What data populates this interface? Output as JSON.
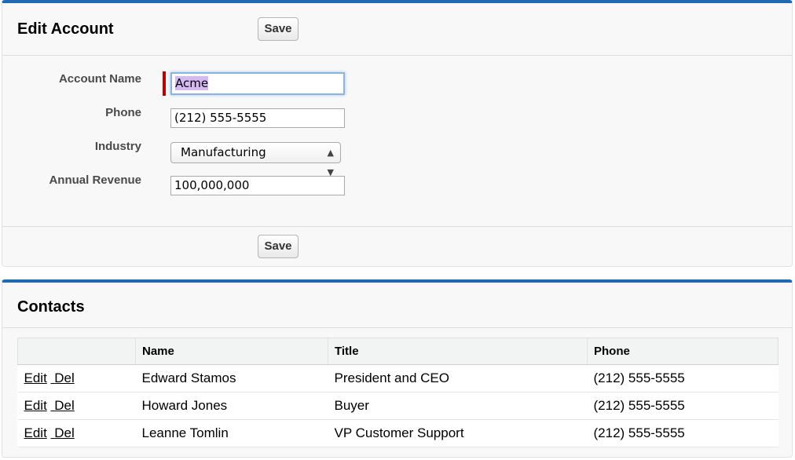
{
  "edit_account": {
    "title": "Edit Account",
    "save_label": "Save",
    "fields": {
      "account_name": {
        "label": "Account Name",
        "value": "Acme"
      },
      "phone": {
        "label": "Phone",
        "value": "(212) 555-5555"
      },
      "industry": {
        "label": "Industry",
        "value": "Manufacturing"
      },
      "annual_revenue": {
        "label": "Annual Revenue",
        "value": "100,000,000"
      }
    }
  },
  "contacts": {
    "title": "Contacts",
    "columns": [
      "",
      "Name",
      "Title",
      "Phone"
    ],
    "edit_label": "Edit",
    "del_label": "Del",
    "rows": [
      {
        "name": "Edward Stamos",
        "title": "President and CEO",
        "phone": "(212) 555-5555"
      },
      {
        "name": "Howard Jones",
        "title": "Buyer",
        "phone": "(212) 555-5555"
      },
      {
        "name": "Leanne Tomlin",
        "title": "VP Customer Support",
        "phone": "(212) 555-5555"
      }
    ]
  },
  "colors": {
    "accent": "#1f6ab3",
    "required": "#c00000",
    "selection": "#d6b8f5"
  }
}
